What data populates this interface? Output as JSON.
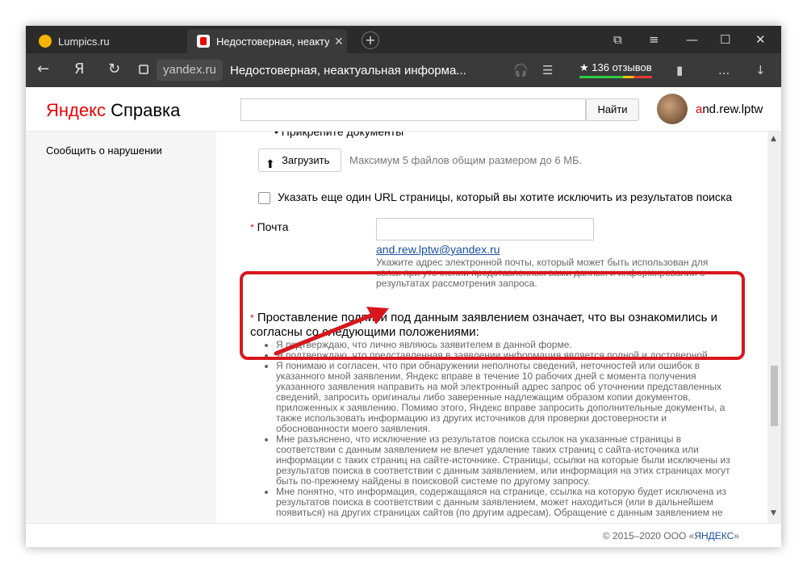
{
  "browser": {
    "tabs": [
      {
        "title": "Lumpics.ru"
      },
      {
        "title": "Недостоверная, неакту"
      }
    ],
    "new_tab": "+",
    "window_controls": {
      "minimize": "—",
      "maximize": "☐",
      "close": "✕",
      "bookmarks": "⧉",
      "menu": "≡"
    },
    "domain": "yandex.ru",
    "page_title": "Недостоверная, неактуальная информа...",
    "reviews": "★ 136 отзывов",
    "more": "...",
    "download": "↓",
    "nav": {
      "back": "←",
      "ya": "Я",
      "reload": "↻"
    }
  },
  "header": {
    "logo_first": "Яндекс",
    "logo_rest": " Справка",
    "search_value": "",
    "find_label": "Найти",
    "user_first": "a",
    "user_rest": "nd.rew.lptw"
  },
  "sidebar": {
    "items": [
      {
        "label": "Сообщить о нарушении"
      }
    ]
  },
  "form": {
    "attach_bullet": "•   Прикрепите документы",
    "upload_label": "Загрузить",
    "upload_icon": "⬆",
    "upload_note": "Максимум 5 файлов общим размером до 6 МБ.",
    "extra_url_label": "Указать еще один URL страницы, который вы хотите исключить из результатов поиска",
    "required_mark": "*",
    "email_label": "Почта",
    "email_value": "",
    "email_suggestion": "and.rew.lptw@yandex.ru",
    "email_hint": "Укажите адрес электронной почты, который может быть использован для связи при уточнении представленных вами данных и информировании о результатах рассмотрения запроса.",
    "agree_title": "Проставление подписи под данным заявлением означает, что вы ознакомились и согласны со следующими положениями:",
    "agree_items": [
      "Я подтверждаю, что лично являюсь заявителем в данной форме.",
      "Я подтверждаю, что представленная в заявлении информация является полной и достоверной.",
      "Я понимаю и согласен, что при обнаружении неполноты сведений, неточностей или ошибок в указанного мной заявлении, Яндекс вправе в течение 10 рабочих дней с момента получения указанного заявления направить на мой электронный адрес запрос об уточнении представленных сведений, запросить оригиналы либо заверенные надлежащим образом копии документов, приложенных к заявлению. Помимо этого, Яндекс вправе запросить дополнительные документы, а также использовать информацию из других источников для проверки достоверности и обоснованности моего заявления.",
      "Мне разъяснено, что исключение из результатов поиска ссылок на указанные страницы в соответствии с данным заявлением не влечет удаление таких страниц с сайта-источника или информации с таких страниц на сайте-источнике. Страницы, ссылки на которые были исключены из результатов поиска в соответствии с данным заявлением, или информация на этих страницах могут быть по-прежнему найдены в поисковой системе по другому запросу.",
      "Мне понятно, что информация, содержащаяся на странице, ссылка на которую будет исключена из результатов поиска в соответствии с данным заявлением, может находиться (или в дальнейшем появиться) на других страницах сайтов (по другим адресам). Обращение с данным заявлением не"
    ]
  },
  "footer": {
    "copyright_prefix": "© 2015–2020 ООО «",
    "copyright_brand": "ЯНДЕКС",
    "copyright_suffix": "»"
  },
  "colors": {
    "highlight_box": "#d8161d",
    "arrow": "#d8161d",
    "brand_red": "#ee0000",
    "link_blue": "#1a4fa0"
  }
}
